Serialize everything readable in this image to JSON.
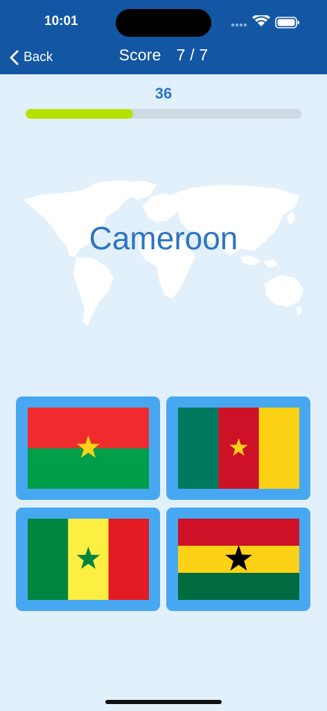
{
  "status": {
    "time": "10:01"
  },
  "nav": {
    "back_label": "Back"
  },
  "score": {
    "label": "Score",
    "value": "7 / 7"
  },
  "progress": {
    "value": "36",
    "fraction": 0.39
  },
  "question": {
    "country": "Cameroon"
  },
  "options": [
    {
      "flag": "burkina-faso",
      "colors": [
        "#ef2b2d",
        "#009e49",
        "#fcd116"
      ]
    },
    {
      "flag": "cameroon",
      "colors": [
        "#007a5e",
        "#ce1126",
        "#fcd116"
      ]
    },
    {
      "flag": "senegal",
      "colors": [
        "#00853f",
        "#fdef42",
        "#e31b23"
      ]
    },
    {
      "flag": "ghana",
      "colors": [
        "#ce1126",
        "#fcd116",
        "#006b3f",
        "#000000"
      ]
    }
  ],
  "colors": {
    "header": "#1357a4",
    "background": "#e2f0fb",
    "accent": "#2b74c7",
    "progress_fill": "#b5e300",
    "option_frame": "#47a8f1"
  }
}
